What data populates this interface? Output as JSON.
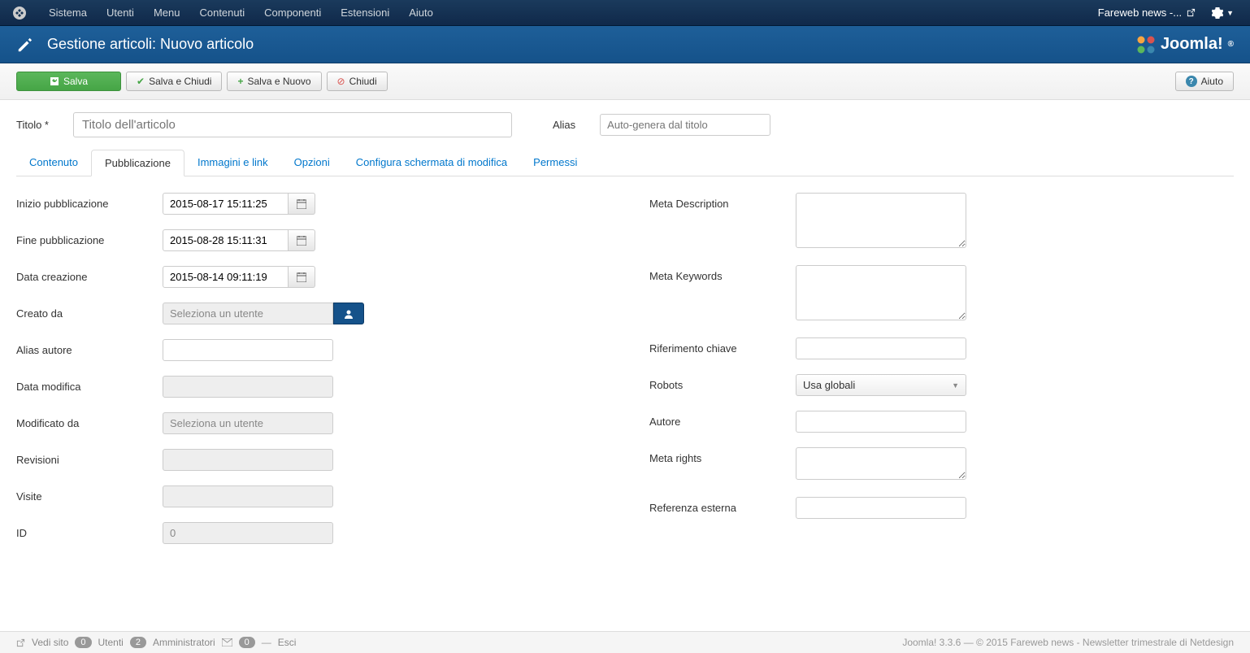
{
  "nav": {
    "menus": [
      "Sistema",
      "Utenti",
      "Menu",
      "Contenuti",
      "Componenti",
      "Estensioni",
      "Aiuto"
    ],
    "site_name": "Fareweb news -..."
  },
  "header": {
    "title": "Gestione articoli: Nuovo articolo",
    "brand": "Joomla!"
  },
  "toolbar": {
    "save": "Salva",
    "save_close": "Salva e Chiudi",
    "save_new": "Salva e Nuovo",
    "close": "Chiudi",
    "help": "Aiuto"
  },
  "title_field": {
    "label": "Titolo *",
    "placeholder": "Titolo dell'articolo",
    "alias_label": "Alias",
    "alias_placeholder": "Auto-genera dal titolo"
  },
  "tabs": [
    "Contenuto",
    "Pubblicazione",
    "Immagini e link",
    "Opzioni",
    "Configura schermata di modifica",
    "Permessi"
  ],
  "pub": {
    "start_label": "Inizio pubblicazione",
    "start_value": "2015-08-17 15:11:25",
    "end_label": "Fine pubblicazione",
    "end_value": "2015-08-28 15:11:31",
    "created_label": "Data creazione",
    "created_value": "2015-08-14 09:11:19",
    "createdby_label": "Creato da",
    "createdby_placeholder": "Seleziona un utente",
    "alias_author_label": "Alias autore",
    "modified_label": "Data modifica",
    "modifiedby_label": "Modificato da",
    "modifiedby_placeholder": "Seleziona un utente",
    "revision_label": "Revisioni",
    "hits_label": "Visite",
    "id_label": "ID",
    "id_value": "0"
  },
  "meta": {
    "desc_label": "Meta Description",
    "keywords_label": "Meta Keywords",
    "keyref_label": "Riferimento chiave",
    "robots_label": "Robots",
    "robots_value": "Usa globali",
    "author_label": "Autore",
    "rights_label": "Meta rights",
    "xref_label": "Referenza esterna"
  },
  "footer": {
    "view_site": "Vedi sito",
    "users_count": "0",
    "users_label": "Utenti",
    "admins_count": "2",
    "admins_label": "Amministratori",
    "msgs_count": "0",
    "logout": "Esci",
    "copyright": "Joomla! 3.3.6  —  © 2015 Fareweb news - Newsletter trimestrale di Netdesign"
  }
}
